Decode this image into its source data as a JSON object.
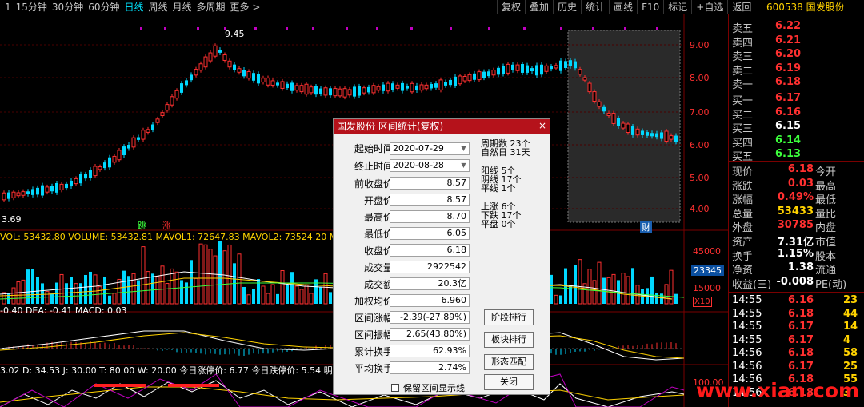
{
  "topbar": {
    "timeframes": [
      "1",
      "15分钟",
      "30分钟",
      "60分钟",
      "日线",
      "周线",
      "月线",
      "多周期",
      "更多 >"
    ],
    "active_index": 4,
    "tools": [
      "复权",
      "叠加",
      "历史",
      "统计",
      "画线",
      "F10",
      "标记",
      "+自选",
      "返回"
    ]
  },
  "stock": {
    "code": "600538",
    "name": "国发股份"
  },
  "price_axis": [
    "9.00",
    "8.00",
    "7.00",
    "6.00",
    "5.00",
    "4.00"
  ],
  "price_labels": {
    "high": "9.45",
    "low": "3.69",
    "marker1": "跳",
    "marker2": "涨",
    "marker3": "财"
  },
  "volume": {
    "label": "VOL: 53432.80  VOLUME: 53432.81  MAVOL1: 72647.83  MAVOL2: 73524.20  MAVOL",
    "axis": [
      "45000",
      "15000"
    ],
    "current": "23345",
    "unit": "X10"
  },
  "macd": {
    "label": "-0.40  DEA: -0.41  MACD: 0.03"
  },
  "kdj": {
    "label": "3.02  D: 34.53  J: 30.00  T: 80.00  W: 20.00  今日涨停价: 6.77  今日跌停价: 5.54  明日涨",
    "axis": "100.00"
  },
  "dialog": {
    "title": "国发股份 区间统计(复权)",
    "close": "×",
    "start_label": "起始时间",
    "start_value": "2020-07-29",
    "end_label": "终止时间",
    "end_value": "2020-08-28",
    "fields": [
      {
        "label": "前收盘价",
        "value": "8.57"
      },
      {
        "label": "开盘价",
        "value": "8.57"
      },
      {
        "label": "最高价",
        "value": "8.70"
      },
      {
        "label": "最低价",
        "value": "6.05"
      },
      {
        "label": "收盘价",
        "value": "6.18"
      },
      {
        "label": "成交量",
        "value": "2922542"
      },
      {
        "label": "成交额",
        "value": "20.3亿"
      },
      {
        "label": "加权均价",
        "value": "6.960"
      },
      {
        "label": "区间涨幅",
        "value": "-2.39(-27.89%)"
      },
      {
        "label": "区间振幅",
        "value": "2.65(43.80%)"
      },
      {
        "label": "累计换手",
        "value": "62.93%"
      },
      {
        "label": "平均换手",
        "value": "2.74%"
      }
    ],
    "stats": [
      {
        "label": "周期数",
        "value": "23个"
      },
      {
        "label": "自然日",
        "value": "31天"
      },
      {
        "label": "阳线",
        "value": "5个"
      },
      {
        "label": "阴线",
        "value": "17个"
      },
      {
        "label": "平线",
        "value": "1个"
      },
      {
        "label": "上涨",
        "value": "6个"
      },
      {
        "label": "下跌",
        "value": "17个"
      },
      {
        "label": "平盘",
        "value": "0个"
      }
    ],
    "buttons": [
      "阶段排行",
      "板块排行",
      "形态匹配",
      "关闭"
    ],
    "checkbox_label": "保留区间显示线"
  },
  "quotes": {
    "asks": [
      {
        "label": "卖五",
        "price": "6.22"
      },
      {
        "label": "卖四",
        "price": "6.21"
      },
      {
        "label": "卖三",
        "price": "6.20"
      },
      {
        "label": "卖二",
        "price": "6.19"
      },
      {
        "label": "卖一",
        "price": "6.18"
      }
    ],
    "bids": [
      {
        "label": "买一",
        "price": "6.17"
      },
      {
        "label": "买二",
        "price": "6.16"
      },
      {
        "label": "买三",
        "price": "6.15"
      },
      {
        "label": "买四",
        "price": "6.14"
      },
      {
        "label": "买五",
        "price": "6.13"
      }
    ],
    "info": [
      {
        "l1": "现价",
        "v1": "6.18",
        "l2": "今开"
      },
      {
        "l1": "涨跌",
        "v1": "0.03",
        "l2": "最高"
      },
      {
        "l1": "涨幅",
        "v1": "0.49%",
        "l2": "最低"
      },
      {
        "l1": "总量",
        "v1": "53433",
        "l2": "量比"
      },
      {
        "l1": "外盘",
        "v1": "30785",
        "l2": "内盘"
      },
      {
        "l1": "资产",
        "v1": "7.31亿",
        "l2": "市值"
      },
      {
        "l1": "换手",
        "v1": "1.15%",
        "l2": "股本"
      },
      {
        "l1": "净资",
        "v1": "1.38",
        "l2": "流通"
      },
      {
        "l1": "收益(三)",
        "v1": "-0.008",
        "l2": "PE(动)"
      }
    ],
    "ticks": [
      {
        "time": "14:55",
        "price": "6.16",
        "vol": "23"
      },
      {
        "time": "14:55",
        "price": "6.18",
        "vol": "44"
      },
      {
        "time": "14:55",
        "price": "6.17",
        "vol": "14"
      },
      {
        "time": "14:55",
        "price": "6.17",
        "vol": "4"
      },
      {
        "time": "14:56",
        "price": "6.18",
        "vol": "58"
      },
      {
        "time": "14:56",
        "price": "6.17",
        "vol": "25"
      },
      {
        "time": "14:56",
        "price": "6.18",
        "vol": "55"
      },
      {
        "time": "14:56",
        "price": "6.18",
        "vol": "3"
      }
    ]
  },
  "watermark": "www.xian.com"
}
